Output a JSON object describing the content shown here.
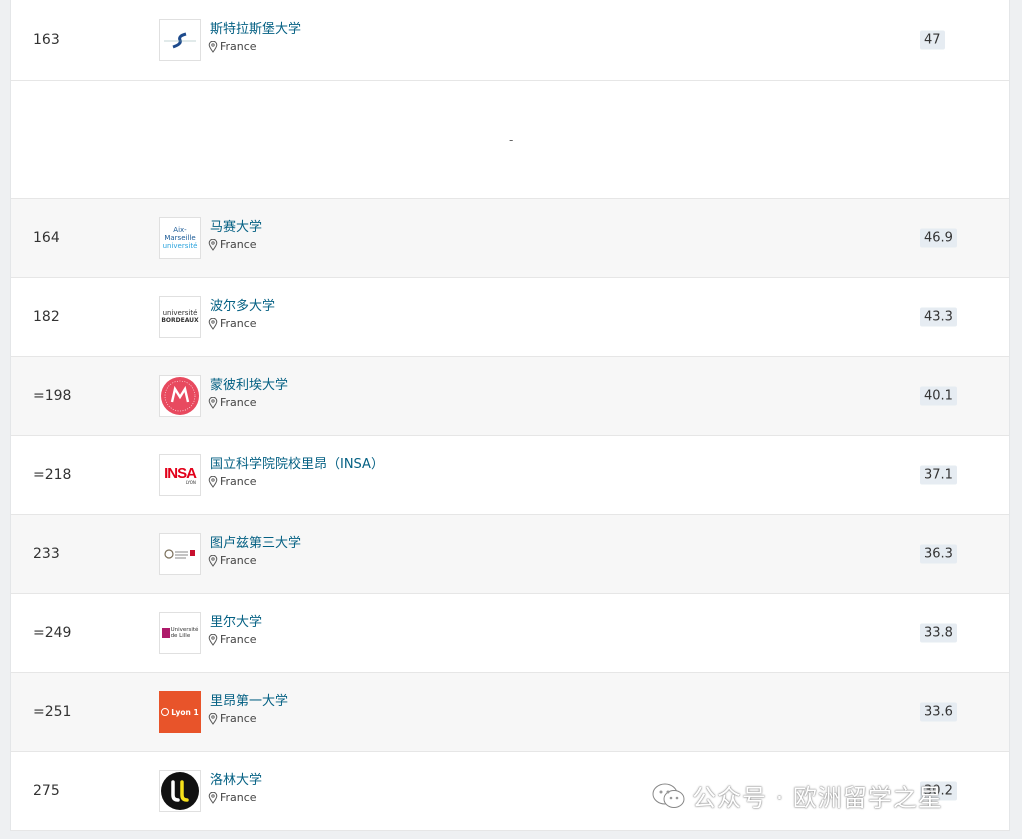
{
  "rows": [
    {
      "rank": "163",
      "name": "斯特拉斯堡大学",
      "country": "France",
      "score": "47",
      "logo": "strasbourg"
    },
    {
      "spacer": "-"
    },
    {
      "rank": "164",
      "name": "马赛大学",
      "country": "France",
      "score": "46.9",
      "logo": "aix",
      "logo_text": "Aix-Marseille",
      "logo_sub": "université"
    },
    {
      "rank": "182",
      "name": "波尔多大学",
      "country": "France",
      "score": "43.3",
      "logo": "bordeaux",
      "logo_text": "université",
      "logo_sub": "BORDEAUX"
    },
    {
      "rank": "=198",
      "name": "蒙彼利埃大学",
      "country": "France",
      "score": "40.1",
      "logo": "montpellier"
    },
    {
      "rank": "=218",
      "name": "国立科学院院校里昂（INSA）",
      "country": "France",
      "score": "37.1",
      "logo": "insa",
      "logo_text": "INSA",
      "logo_sub": "LYON"
    },
    {
      "rank": "233",
      "name": "图卢兹第三大学",
      "country": "France",
      "score": "36.3",
      "logo": "toulouse"
    },
    {
      "rank": "=249",
      "name": "里尔大学",
      "country": "France",
      "score": "33.8",
      "logo": "lille",
      "logo_text": "Université",
      "logo_sub": "de Lille"
    },
    {
      "rank": "=251",
      "name": "里昂第一大学",
      "country": "France",
      "score": "33.6",
      "logo": "lyon1",
      "logo_text": "Lyon 1"
    },
    {
      "rank": "275",
      "name": "洛林大学",
      "country": "France",
      "score": "30.2",
      "logo": "lorraine",
      "logo_text": "UL"
    }
  ],
  "watermark": "公众号 · 欧洲留学之星",
  "colors": {
    "link": "#046083",
    "score_bg": "#e6ecf2",
    "alt_row": "#f7f7f7"
  }
}
